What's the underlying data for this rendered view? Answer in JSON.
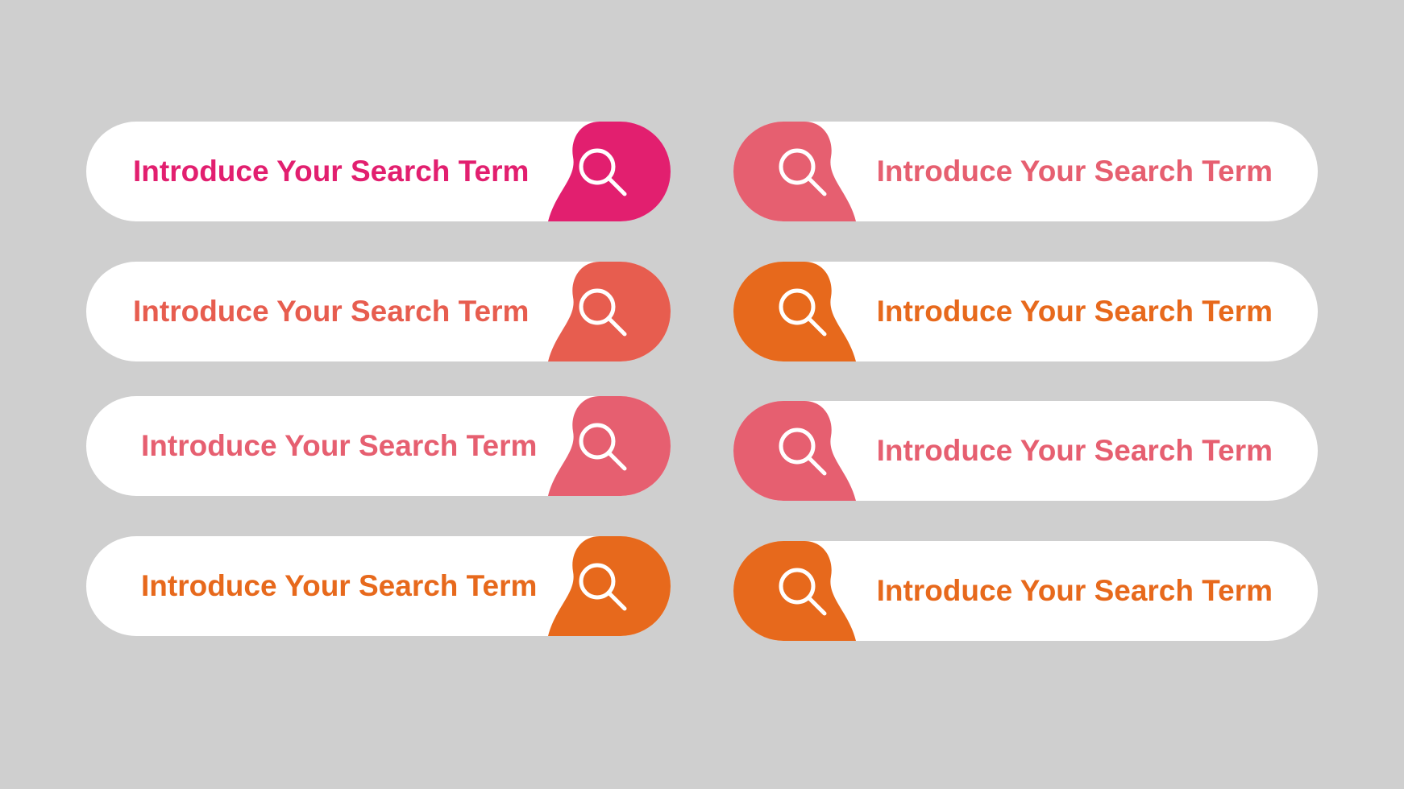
{
  "search_bars": [
    {
      "text": "Introduce Your Search Term",
      "color": "#E21F6F",
      "icon": "search-icon"
    },
    {
      "text": "Introduce Your Search Term",
      "color": "#E75D4F",
      "icon": "search-icon"
    },
    {
      "text": "Introduce Your Search Term",
      "color": "#E65F70",
      "icon": "search-icon"
    },
    {
      "text": "Introduce Your Search Term",
      "color": "#E7691C",
      "icon": "search-icon"
    },
    {
      "text": "Introduce Your Search Term",
      "color": "#E65F70",
      "icon": "search-icon"
    },
    {
      "text": "Introduce Your Search Term",
      "color": "#E7691C",
      "icon": "search-icon"
    },
    {
      "text": "Introduce Your Search Term",
      "color": "#E65F70",
      "icon": "search-icon"
    },
    {
      "text": "Introduce Your Search Term",
      "color": "#E7691C",
      "icon": "search-icon"
    }
  ]
}
